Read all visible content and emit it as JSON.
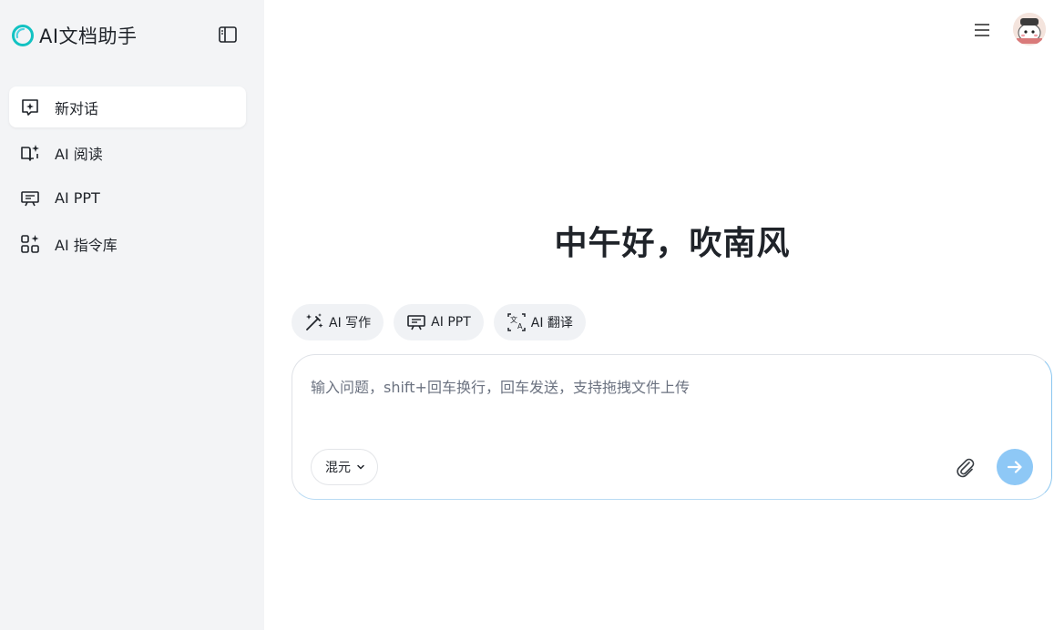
{
  "app": {
    "name": "AI文档助手"
  },
  "sidebar": {
    "items": [
      {
        "label": "新对话",
        "icon": "new-chat-icon",
        "active": true
      },
      {
        "label": "AI 阅读",
        "icon": "book-sparkle-icon"
      },
      {
        "label": "AI PPT",
        "icon": "presentation-icon"
      },
      {
        "label": "AI 指令库",
        "icon": "apps-sparkle-icon"
      }
    ]
  },
  "main": {
    "greeting": "中午好，吹南风",
    "quick_actions": [
      {
        "label": "AI 写作",
        "icon": "magic-pen-icon"
      },
      {
        "label": "AI PPT",
        "icon": "presentation-icon"
      },
      {
        "label": "AI 翻译",
        "icon": "translate-icon"
      }
    ],
    "input": {
      "placeholder": "输入问题，shift+回车换行，回车发送，支持拖拽文件上传",
      "value": ""
    },
    "model": {
      "selected": "混元"
    }
  },
  "colors": {
    "sidebar_bg": "#f3f4f6",
    "accent": "#8ec8f6",
    "logo": "#12c2c2"
  }
}
